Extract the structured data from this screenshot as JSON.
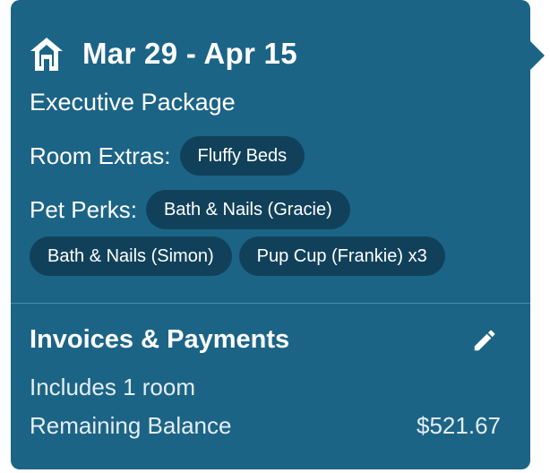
{
  "booking": {
    "date_range": "Mar 29 - Apr 15",
    "package": "Executive Package",
    "room_extras_label": "Room Extras:",
    "room_extras": [
      "Fluffy Beds"
    ],
    "pet_perks_label": "Pet Perks:",
    "pet_perks": [
      "Bath & Nails (Gracie)",
      "Bath & Nails (Simon)",
      "Pup Cup (Frankie) x3"
    ]
  },
  "invoices": {
    "title": "Invoices & Payments",
    "includes": "Includes 1 room",
    "balance_label": "Remaining Balance",
    "balance_value": "$521.67"
  },
  "icons": {
    "home": "home-icon",
    "edit": "pencil-icon"
  },
  "colors": {
    "card_background": "#1c6486",
    "pill_background": "#11415a",
    "text": "#ffffff"
  }
}
